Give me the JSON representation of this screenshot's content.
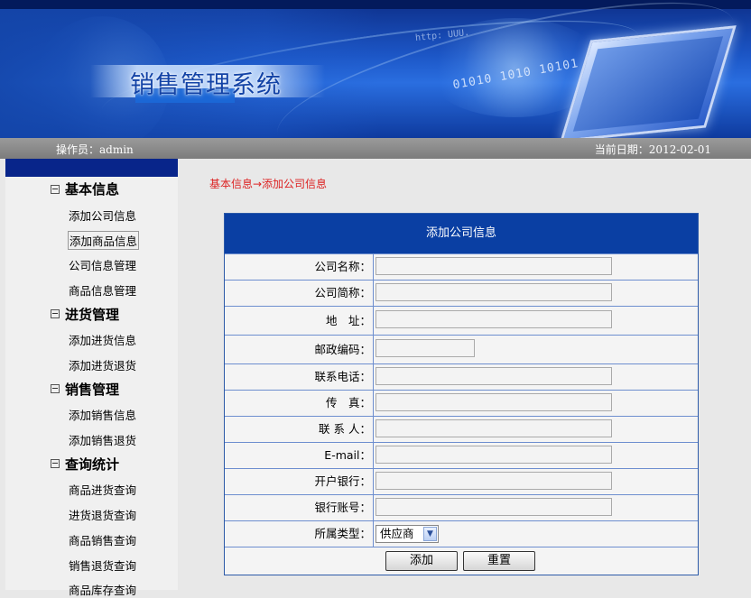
{
  "header": {
    "title": "销售管理系统",
    "operator_text": "操作员：admin",
    "date_text": "当前日期：2012-02-01"
  },
  "sidebar": {
    "groups": [
      {
        "label": "基本信息",
        "items": [
          "添加公司信息",
          "添加商品信息",
          "公司信息管理",
          "商品信息管理"
        ]
      },
      {
        "label": "进货管理",
        "items": [
          "添加进货信息",
          "添加进货退货"
        ]
      },
      {
        "label": "销售管理",
        "items": [
          "添加销售信息",
          "添加销售退货"
        ]
      },
      {
        "label": "查询统计",
        "items": [
          "商品进货查询",
          "进货退货查询",
          "商品销售查询",
          "销售退货查询",
          "商品库存查询"
        ]
      }
    ],
    "selected_item": "添加商品信息"
  },
  "breadcrumb": "基本信息→添加公司信息",
  "form": {
    "title": "添加公司信息",
    "fields": [
      {
        "label": "公司名称：",
        "value": ""
      },
      {
        "label": "公司简称：",
        "value": ""
      },
      {
        "label": "地　址：",
        "value": ""
      },
      {
        "label": "邮政编码：",
        "value": ""
      },
      {
        "label": "联系电话：",
        "value": ""
      },
      {
        "label": "传　真：",
        "value": ""
      },
      {
        "label": "联 系 人：",
        "value": ""
      },
      {
        "label": "E-mail：",
        "value": ""
      },
      {
        "label": "开户银行：",
        "value": ""
      },
      {
        "label": "银行账号：",
        "value": ""
      }
    ],
    "type_label": "所属类型：",
    "type_selected": "供应商",
    "submit_label": "添加",
    "reset_label": "重置"
  },
  "colors": {
    "banner": "#1c56c6",
    "sidebar_head": "#08258a",
    "form_head": "#0a3fa3",
    "breadcrumb": "#dd2222"
  }
}
